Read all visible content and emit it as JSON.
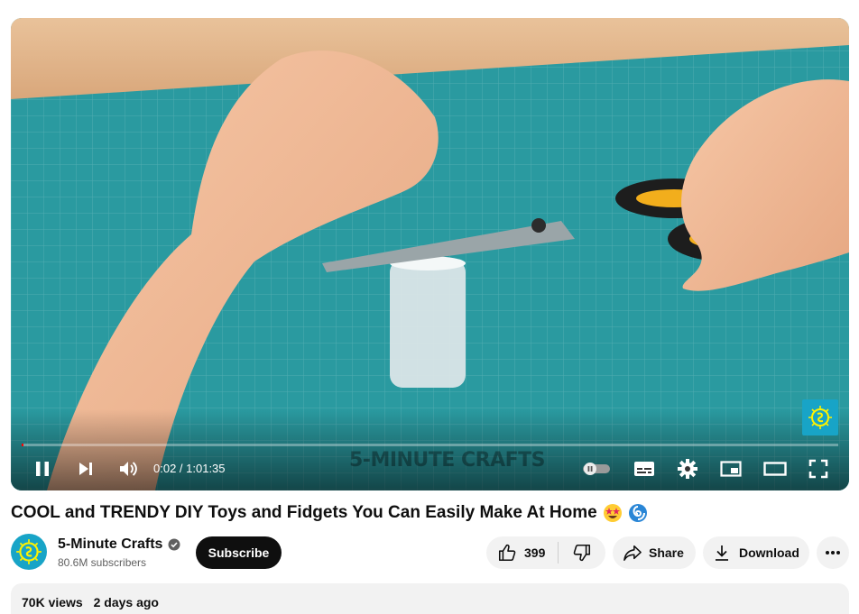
{
  "player": {
    "time_display": "0:02 / 1:01:35",
    "progress_fraction": 0.0005,
    "watermark": "5-MINUTE CRAFTS",
    "controls": [
      "pause-icon",
      "next-icon",
      "volume-icon",
      "autoplay-toggle",
      "subtitles-icon",
      "settings-gear-icon",
      "miniplayer-icon",
      "theater-mode-icon",
      "fullscreen-icon"
    ]
  },
  "video": {
    "title": "COOL and TRENDY DIY Toys and Fidgets You Can Easily Make At Home"
  },
  "channel": {
    "name": "5-Minute Crafts",
    "subscribers": "80.6M subscribers",
    "subscribe_label": "Subscribe"
  },
  "actions": {
    "like_count": "399",
    "share_label": "Share",
    "download_label": "Download"
  },
  "description": {
    "views": "70K views",
    "date": "2 days ago"
  },
  "colors": {
    "mat": "#2a9aa0",
    "brand": "#18a4c7",
    "progress": "#ff0000",
    "button_dark": "#0f0f0f",
    "pill_bg": "#f2f2f2"
  }
}
